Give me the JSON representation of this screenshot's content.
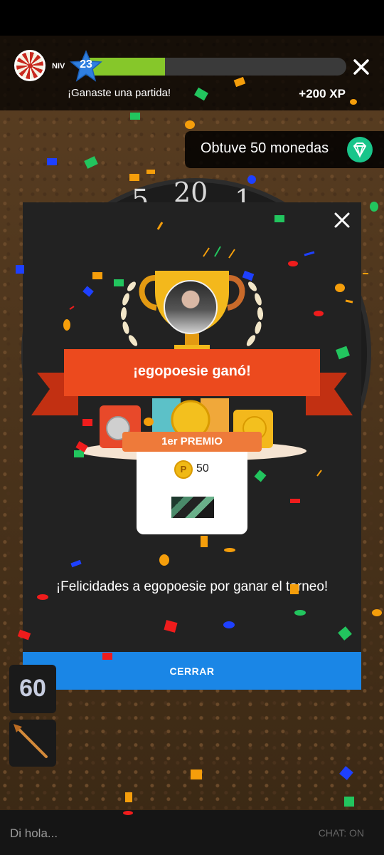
{
  "header": {
    "level_prefix": "NIV",
    "level": "23",
    "xp_progress": 0.32,
    "won_message": "¡Ganaste una partida!",
    "xp_gain": "+200 XP"
  },
  "toast": {
    "text": "Obtuve 50 monedas",
    "icon": "gem-icon"
  },
  "modal": {
    "winner_banner": "¡egopoesie ganó!",
    "prize_label": "1er PREMIO",
    "coin_amount": "50",
    "congrats": "¡Felicidades a egopoesie por ganar el torneo!",
    "close_button": "CERRAR"
  },
  "background": {
    "board_numbers": [
      "5",
      "20",
      "1"
    ],
    "score_tile": "60"
  },
  "chat": {
    "placeholder": "Di hola...",
    "toggle": "CHAT: ON"
  },
  "colors": {
    "xp_fill": "#86c72a",
    "banner": "#e8401c",
    "button": "#1a86e6",
    "gem": "#19c58a",
    "modal_bg": "#222222"
  }
}
